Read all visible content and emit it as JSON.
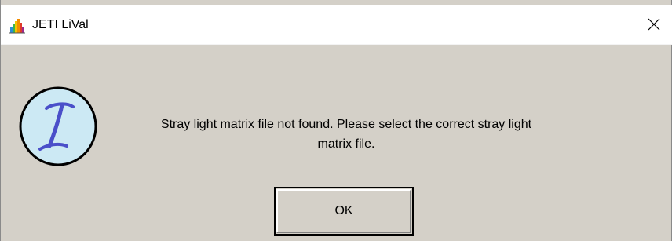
{
  "window": {
    "title": "JETI LiVal",
    "app_icon": "jeti-spectrum-icon",
    "close_icon": "close-icon",
    "close_symbol": "✕"
  },
  "dialog": {
    "icon": "information-icon",
    "message_line1": "Stray light matrix file not found. Please select the correct stray light",
    "message_line2": "matrix file.",
    "ok_label": "OK"
  },
  "colors": {
    "dialog_background": "#d4d0c8",
    "titlebar_background": "#ffffff",
    "info_icon_fill": "#cce9f4",
    "info_icon_glyph": "#4a4fc9"
  }
}
